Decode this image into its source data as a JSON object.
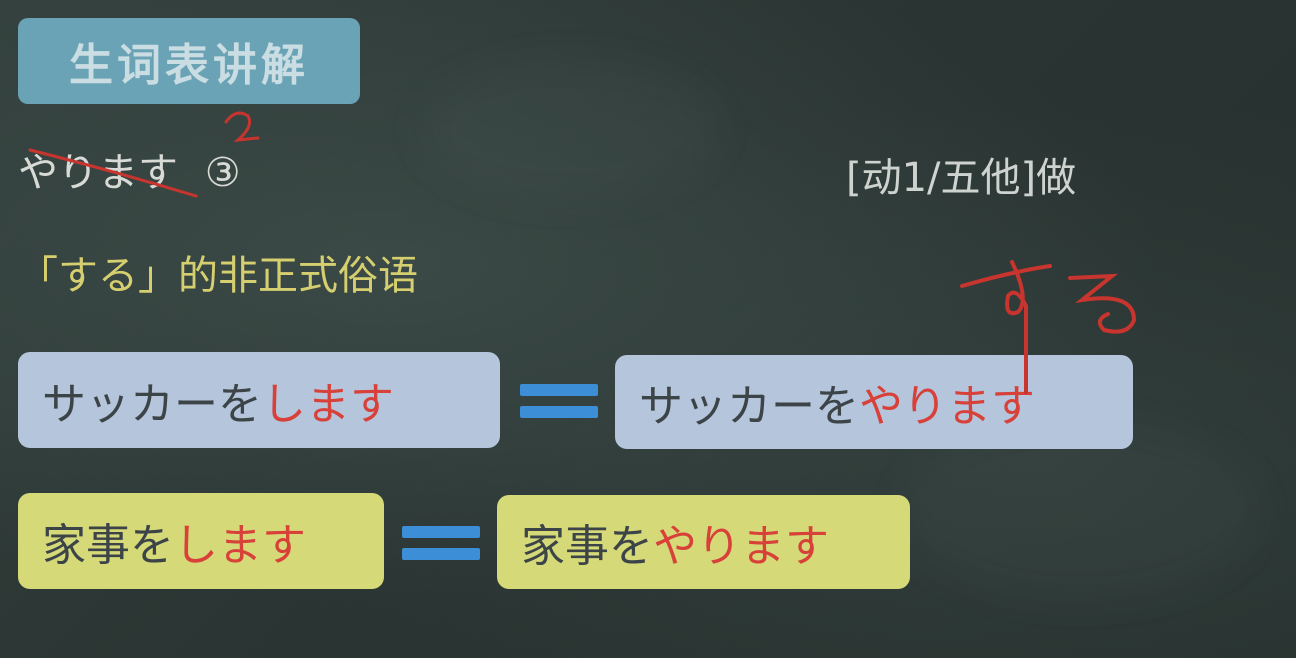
{
  "title": "生词表讲解",
  "entry": {
    "word": "やります",
    "accent": "③",
    "part_of_speech": "[动1/五他]做",
    "note": "「する」的非正式俗语"
  },
  "examples": [
    {
      "left": {
        "prefix": "サッカーを",
        "highlight": "します"
      },
      "equals": "=",
      "right": {
        "prefix": "サッカーを",
        "highlight": "やります"
      }
    },
    {
      "left": {
        "prefix": "家事を",
        "highlight": "します"
      },
      "equals": "=",
      "right": {
        "prefix": "家事を",
        "highlight": "やります"
      }
    }
  ],
  "handwriting": {
    "accent_mark": "2",
    "side_note": "する"
  },
  "colors": {
    "board": "#2b3533",
    "title_badge": "#6aa3b5",
    "blue_box": "#b4c5dc",
    "yellow_box": "#d5d977",
    "highlight_red": "#d8413a",
    "equals_blue": "#3c8fd6",
    "note_yellow": "#d6cf70"
  }
}
